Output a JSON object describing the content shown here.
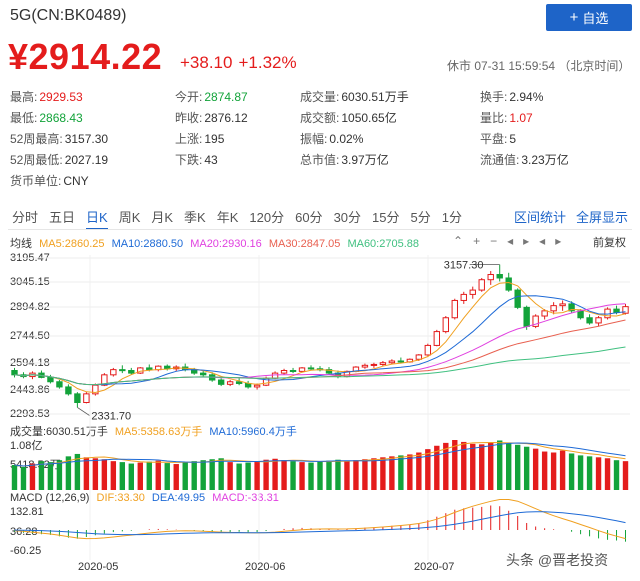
{
  "header": {
    "title": "5G(CN:BK0489)",
    "follow_label": "自选",
    "price": "¥2914.22",
    "change": "+38.10",
    "change_pct": "+1.32%",
    "market_time": "休市 07-31 15:59:54 （北京时间）"
  },
  "stats": [
    {
      "label": "最高:",
      "value": "2929.53",
      "color": "red"
    },
    {
      "label": "今开:",
      "value": "2874.87",
      "color": "green"
    },
    {
      "label": "成交量:",
      "value": "6030.51万手",
      "color": ""
    },
    {
      "label": "换手:",
      "value": "2.94%",
      "color": ""
    },
    {
      "label": "最低:",
      "value": "2868.43",
      "color": "green"
    },
    {
      "label": "昨收:",
      "value": "2876.12",
      "color": ""
    },
    {
      "label": "成交额:",
      "value": "1050.65亿",
      "color": ""
    },
    {
      "label": "量比:",
      "value": "1.07",
      "color": "red"
    },
    {
      "label": "52周最高:",
      "value": "3157.30",
      "color": ""
    },
    {
      "label": "上涨:",
      "value": "195",
      "color": ""
    },
    {
      "label": "振幅:",
      "value": "0.02%",
      "color": ""
    },
    {
      "label": "平盘:",
      "value": "5",
      "color": ""
    },
    {
      "label": "52周最低:",
      "value": "2027.19",
      "color": ""
    },
    {
      "label": "下跌:",
      "value": "43",
      "color": ""
    },
    {
      "label": "总市值:",
      "value": "3.97万亿",
      "color": ""
    },
    {
      "label": "流通值:",
      "value": "3.23万亿",
      "color": ""
    },
    {
      "label": "货币单位:",
      "value": "CNY",
      "color": ""
    }
  ],
  "tabs": [
    "分时",
    "五日",
    "日K",
    "周K",
    "月K",
    "季K",
    "年K",
    "120分",
    "60分",
    "30分",
    "15分",
    "5分",
    "1分"
  ],
  "active_tab": "日K",
  "links": {
    "stats": "区间统计",
    "fullscreen": "全屏显示"
  },
  "kline_legend": {
    "name": "均线",
    "ma5": "MA5:2860.25",
    "ma10": "MA10:2880.50",
    "ma20": "MA20:2930.16",
    "ma30": "MA30:2847.05",
    "ma60": "MA60:2705.88"
  },
  "toolbar": {
    "fq_label": "前复权",
    "icons": [
      "collapse-icon",
      "zoom-in-icon",
      "zoom-out-icon",
      "pan-left-icon",
      "pan-right-icon",
      "move-left-icon",
      "move-right-icon"
    ]
  },
  "y_axis_price": [
    "3195.47",
    "3045.15",
    "2894.82",
    "2744.50",
    "2594.18",
    "2443.86",
    "2293.53"
  ],
  "high_annotation": "3157.30",
  "low_annotation": "2331.70",
  "volume": {
    "legend_name": "成交量:6030.51万手",
    "ma5": "MA5:5358.63万手",
    "ma10": "MA10:5960.4万手",
    "y_top": "1.08亿",
    "y_mid": "5418.52万"
  },
  "macd": {
    "legend_name": "MACD (12,26,9)",
    "dif": "DIF:33.30",
    "dea": "DEA:49.95",
    "macd": "MACD:-33.31",
    "y_labels": [
      "132.81",
      "36.28",
      "-60.25"
    ]
  },
  "x_labels": [
    "2020-05",
    "2020-06",
    "2020-07"
  ],
  "watermark": "头条 @晋老投资",
  "colors": {
    "up": "#e41c1c",
    "down": "#13a33a",
    "ma5": "#f0a020",
    "ma10": "#1e6ad6",
    "ma20": "#e040e0",
    "ma30": "#e86050",
    "ma60": "#40c080",
    "accent": "#1e64c8"
  },
  "chart_data": {
    "type": "candlestick",
    "ylim": [
      2293.53,
      3195.47
    ],
    "ohlc": [
      [
        2545,
        2560,
        2505,
        2520
      ],
      [
        2520,
        2535,
        2500,
        2510
      ],
      [
        2510,
        2540,
        2495,
        2530
      ],
      [
        2530,
        2545,
        2500,
        2505
      ],
      [
        2505,
        2520,
        2470,
        2480
      ],
      [
        2480,
        2490,
        2440,
        2450
      ],
      [
        2450,
        2465,
        2400,
        2410
      ],
      [
        2410,
        2420,
        2331.7,
        2360
      ],
      [
        2360,
        2420,
        2355,
        2410
      ],
      [
        2410,
        2470,
        2400,
        2460
      ],
      [
        2460,
        2530,
        2455,
        2520
      ],
      [
        2520,
        2560,
        2510,
        2550
      ],
      [
        2550,
        2575,
        2530,
        2545
      ],
      [
        2545,
        2560,
        2520,
        2530
      ],
      [
        2530,
        2565,
        2525,
        2560
      ],
      [
        2560,
        2580,
        2540,
        2550
      ],
      [
        2550,
        2575,
        2540,
        2570
      ],
      [
        2570,
        2580,
        2545,
        2555
      ],
      [
        2555,
        2575,
        2540,
        2565
      ],
      [
        2565,
        2585,
        2540,
        2550
      ],
      [
        2550,
        2560,
        2520,
        2530
      ],
      [
        2530,
        2545,
        2505,
        2520
      ],
      [
        2520,
        2535,
        2480,
        2490
      ],
      [
        2490,
        2500,
        2455,
        2465
      ],
      [
        2465,
        2490,
        2455,
        2480
      ],
      [
        2480,
        2500,
        2460,
        2470
      ],
      [
        2470,
        2485,
        2440,
        2450
      ],
      [
        2450,
        2470,
        2435,
        2460
      ],
      [
        2460,
        2510,
        2455,
        2500
      ],
      [
        2500,
        2540,
        2495,
        2530
      ],
      [
        2530,
        2555,
        2520,
        2545
      ],
      [
        2545,
        2560,
        2530,
        2540
      ],
      [
        2540,
        2565,
        2535,
        2560
      ],
      [
        2560,
        2575,
        2545,
        2555
      ],
      [
        2555,
        2570,
        2540,
        2550
      ],
      [
        2550,
        2565,
        2520,
        2530
      ],
      [
        2530,
        2545,
        2500,
        2510
      ],
      [
        2510,
        2545,
        2505,
        2540
      ],
      [
        2540,
        2570,
        2535,
        2565
      ],
      [
        2565,
        2585,
        2555,
        2575
      ],
      [
        2575,
        2590,
        2560,
        2580
      ],
      [
        2580,
        2600,
        2570,
        2590
      ],
      [
        2590,
        2610,
        2580,
        2600
      ],
      [
        2600,
        2620,
        2585,
        2595
      ],
      [
        2595,
        2615,
        2590,
        2610
      ],
      [
        2610,
        2640,
        2600,
        2635
      ],
      [
        2635,
        2700,
        2630,
        2690
      ],
      [
        2690,
        2780,
        2685,
        2770
      ],
      [
        2770,
        2860,
        2760,
        2850
      ],
      [
        2850,
        2960,
        2840,
        2950
      ],
      [
        2950,
        3000,
        2930,
        2985
      ],
      [
        2985,
        3030,
        2960,
        3010
      ],
      [
        3010,
        3080,
        3000,
        3070
      ],
      [
        3070,
        3120,
        3040,
        3100
      ],
      [
        3100,
        3157.3,
        3060,
        3080
      ],
      [
        3080,
        3110,
        3000,
        3010
      ],
      [
        3010,
        3020,
        2900,
        2910
      ],
      [
        2910,
        2920,
        2780,
        2800
      ],
      [
        2800,
        2870,
        2790,
        2860
      ],
      [
        2860,
        2900,
        2840,
        2890
      ],
      [
        2890,
        2940,
        2870,
        2920
      ],
      [
        2920,
        2950,
        2890,
        2930
      ],
      [
        2930,
        2945,
        2880,
        2890
      ],
      [
        2890,
        2900,
        2840,
        2850
      ],
      [
        2850,
        2870,
        2810,
        2820
      ],
      [
        2820,
        2860,
        2800,
        2850
      ],
      [
        2850,
        2910,
        2840,
        2900
      ],
      [
        2900,
        2920,
        2870,
        2880
      ],
      [
        2876.12,
        2929.53,
        2868.43,
        2914.22
      ]
    ],
    "volume": [
      52,
      48,
      55,
      60,
      58,
      62,
      70,
      75,
      68,
      66,
      64,
      60,
      58,
      55,
      57,
      59,
      61,
      56,
      54,
      58,
      60,
      62,
      64,
      66,
      58,
      55,
      57,
      59,
      63,
      65,
      62,
      60,
      58,
      57,
      59,
      61,
      63,
      60,
      62,
      64,
      66,
      68,
      70,
      72,
      74,
      78,
      85,
      92,
      98,
      104,
      100,
      96,
      95,
      99,
      103,
      97,
      94,
      90,
      86,
      80,
      78,
      82,
      76,
      72,
      70,
      68,
      66,
      62,
      60
    ],
    "macd_bars": [
      -5,
      -8,
      -10,
      -12,
      -14,
      -18,
      -22,
      -25,
      -20,
      -15,
      -10,
      -6,
      -4,
      -2,
      0,
      2,
      3,
      2,
      1,
      0,
      -2,
      -4,
      -6,
      -8,
      -6,
      -5,
      -7,
      -6,
      -3,
      0,
      3,
      5,
      6,
      5,
      4,
      2,
      1,
      3,
      5,
      7,
      8,
      10,
      12,
      14,
      16,
      20,
      28,
      38,
      48,
      58,
      62,
      64,
      66,
      70,
      68,
      55,
      40,
      20,
      10,
      5,
      2,
      0,
      -5,
      -12,
      -18,
      -24,
      -28,
      -30,
      -33.31
    ]
  }
}
